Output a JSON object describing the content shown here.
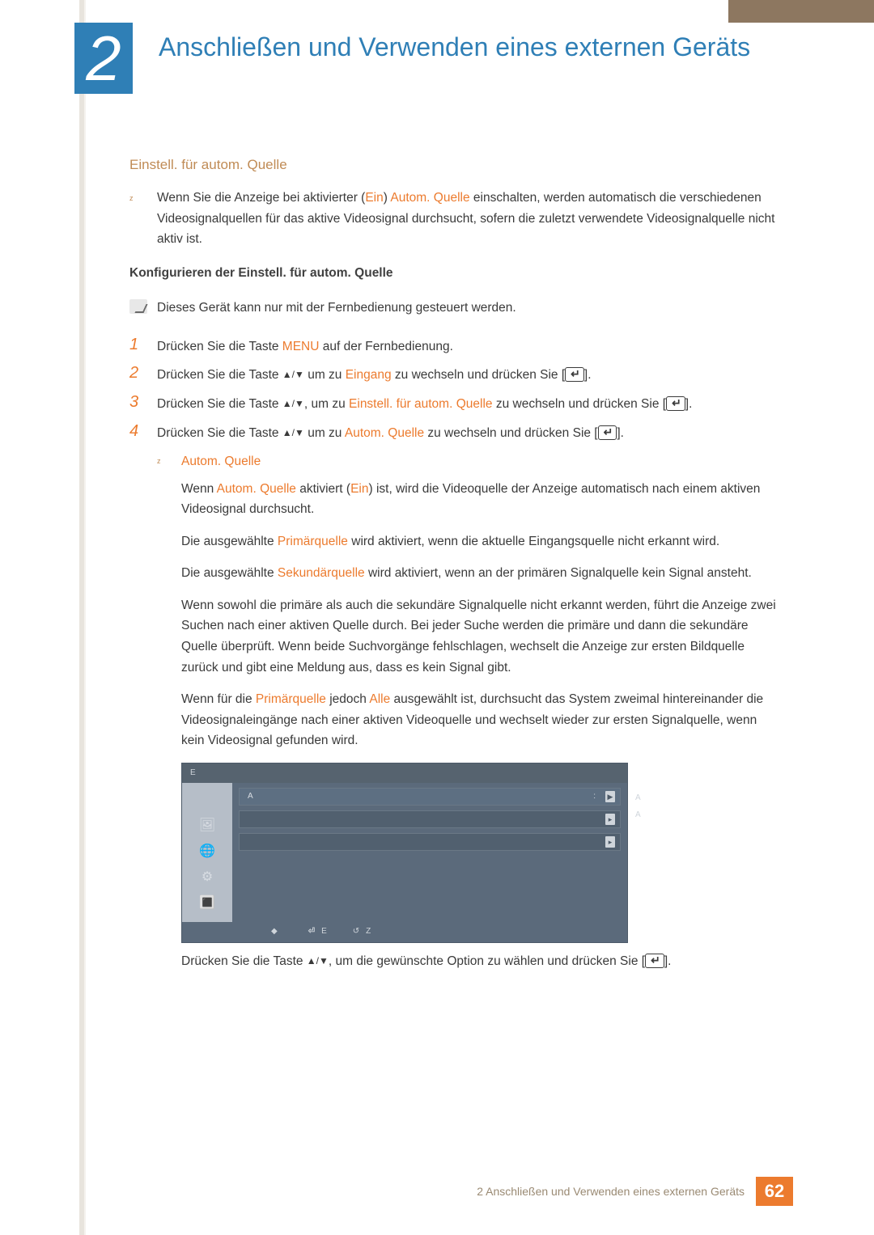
{
  "chapter": {
    "number": "2",
    "title": "Anschließen und Verwenden eines externen Geräts"
  },
  "section": {
    "heading": "Einstell. für autom. Quelle"
  },
  "intro": {
    "pre": "Wenn Sie die Anzeige bei aktivierter (",
    "ein": "Ein",
    "mid1": ") ",
    "autoq": "Autom. Quelle",
    "post": " einschalten, werden automatisch die verschiedenen Videosignalquellen für das aktive Videosignal durchsucht, sofern die zuletzt verwendete Videosignalquelle nicht aktiv ist."
  },
  "config_heading": "Konfigurieren der Einstell. für autom. Quelle",
  "note": "Dieses Gerät kann nur mit der Fernbedienung gesteuert werden.",
  "steps": {
    "s1_a": "Drücken Sie die Taste ",
    "s1_menu": "MENU",
    "s1_b": " auf der Fernbedienung.",
    "s2_a": "Drücken Sie die Taste ",
    "updown": "▲/▼",
    "s2_b": " um zu ",
    "s2_eingang": "Eingang",
    "s2_c": " zu wechseln und drücken Sie [",
    "close": "].",
    "s3_a": "Drücken Sie die Taste ",
    "s3_b": ", um zu ",
    "s3_target": "Einstell. für autom. Quelle",
    "s3_c": " zu wechseln und drücken Sie [",
    "s4_a": "Drücken Sie die Taste ",
    "s4_b": " um zu ",
    "s4_target": "Autom. Quelle",
    "s4_c": " zu wechseln und drücken Sie ["
  },
  "autom": {
    "title": "Autom. Quelle",
    "p1_a": "Wenn ",
    "p1_aq": "Autom. Quelle",
    "p1_b": " aktiviert (",
    "p1_ein": "Ein",
    "p1_c": ") ist, wird die Videoquelle der Anzeige automatisch nach einem aktiven Videosignal durchsucht.",
    "p2_a": "Die ausgewählte ",
    "p2_pq": "Primärquelle",
    "p2_b": " wird aktiviert, wenn die aktuelle Eingangsquelle nicht erkannt wird.",
    "p3_a": "Die ausgewählte ",
    "p3_sq": "Sekundärquelle",
    "p3_b": " wird aktiviert, wenn an der primären Signalquelle kein Signal ansteht.",
    "p4": "Wenn sowohl die primäre als auch die sekundäre Signalquelle nicht erkannt werden, führt die Anzeige zwei Suchen nach einer aktiven Quelle durch. Bei jeder Suche werden die primäre und dann die sekundäre Quelle überprüft. Wenn beide Suchvorgänge fehlschlagen, wechselt die Anzeige zur ersten Bildquelle zurück und gibt eine Meldung aus, dass es kein Signal gibt.",
    "p5_a": "Wenn für die ",
    "p5_pq": "Primärquelle",
    "p5_b": " jedoch ",
    "p5_alle": "Alle",
    "p5_c": " ausgewählt ist, durchsucht das System zweimal hintereinander die Videosignaleingänge nach einer aktiven Videoquelle und wechselt wieder zur ersten Signalquelle, wenn kein Videosignal gefunden wird."
  },
  "osd": {
    "title": "E",
    "rows": [
      {
        "label": "A",
        "value": ":"
      },
      {
        "label": "",
        "value": ""
      },
      {
        "label": "",
        "value": ""
      }
    ],
    "hints": [
      "A",
      "A",
      ""
    ],
    "icons": [
      "🖼",
      "🌐",
      "⚙",
      "🔳"
    ],
    "footer": {
      "move": "",
      "enter": "E",
      "back": "Z"
    }
  },
  "below": {
    "a": "Drücken Sie die Taste ",
    "b": ", um die gewünschte Option zu wählen und drücken Sie ["
  },
  "footer": {
    "text": "2 Anschließen und Verwenden eines externen Geräts",
    "page": "62"
  }
}
